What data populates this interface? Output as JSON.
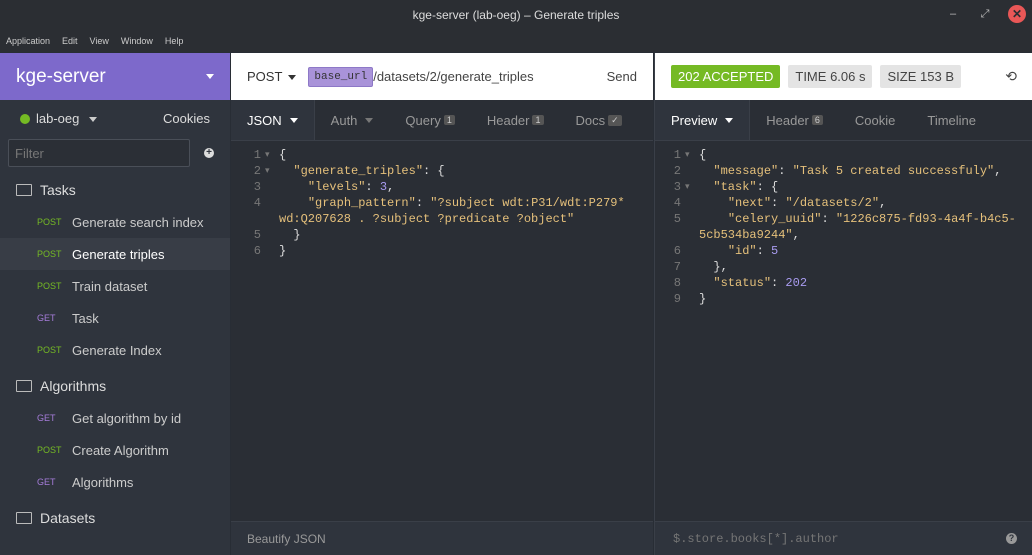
{
  "window": {
    "title": "kge-server (lab-oeg) – Generate triples",
    "minimize": "–",
    "restore": "⤢",
    "close": "✕"
  },
  "menu": [
    "Application",
    "Edit",
    "View",
    "Window",
    "Help"
  ],
  "sidebar": {
    "workspace": "kge-server",
    "environment": "lab-oeg",
    "cookies": "Cookies",
    "filter_placeholder": "Filter",
    "folders": [
      {
        "name": "Tasks",
        "items": [
          {
            "method": "POST",
            "label": "Generate search index"
          },
          {
            "method": "POST",
            "label": "Generate triples"
          },
          {
            "method": "POST",
            "label": "Train dataset"
          },
          {
            "method": "GET",
            "label": "Task"
          },
          {
            "method": "POST",
            "label": "Generate Index"
          }
        ]
      },
      {
        "name": "Algorithms",
        "items": [
          {
            "method": "GET",
            "label": "Get algorithm by id"
          },
          {
            "method": "POST",
            "label": "Create Algorithm"
          },
          {
            "method": "GET",
            "label": "Algorithms"
          }
        ]
      },
      {
        "name": "Datasets",
        "items": []
      }
    ]
  },
  "request": {
    "method": "POST",
    "base_url_pill": "base_url",
    "path": "/datasets/2/generate_triples",
    "send": "Send",
    "tabs": [
      {
        "label": "JSON",
        "count": ""
      },
      {
        "label": "Auth",
        "count": ""
      },
      {
        "label": "Query",
        "count": "1"
      },
      {
        "label": "Header",
        "count": "1"
      },
      {
        "label": "Docs",
        "count": "✓"
      }
    ],
    "footer": "Beautify JSON"
  },
  "response": {
    "status": "202 ACCEPTED",
    "time_label": "TIME",
    "time": "6.06 s",
    "size_label": "SIZE",
    "size": "153 B",
    "tabs": [
      {
        "label": "Preview",
        "count": ""
      },
      {
        "label": "Header",
        "count": "6"
      },
      {
        "label": "Cookie",
        "count": ""
      },
      {
        "label": "Timeline",
        "count": ""
      }
    ],
    "filter_placeholder": "$.store.books[*].author"
  },
  "colors": {
    "accent": "#7d69cb",
    "success": "#75ba24",
    "post": "#75ba24",
    "get": "#a57cd9"
  }
}
